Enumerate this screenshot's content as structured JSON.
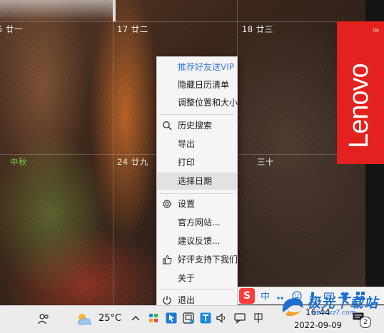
{
  "calendar": {
    "cells": [
      {
        "label": "5 廿一"
      },
      {
        "label": "17 廿二"
      },
      {
        "label": "18 廿三"
      },
      {
        "label": "中秋"
      },
      {
        "label": "24 廿九"
      },
      {
        "label": "三十"
      }
    ]
  },
  "brand": {
    "logo_text": "Lenovo",
    "tm": "TM",
    "color": "#e3211e"
  },
  "context_menu": {
    "items": [
      {
        "label": "推荐好友送VIP",
        "icon": ""
      },
      {
        "label": "隐藏日历清单",
        "icon": ""
      },
      {
        "label": "调整位置和大小",
        "icon": ""
      },
      {
        "label": "历史搜索",
        "icon": "search-icon"
      },
      {
        "label": "导出",
        "icon": ""
      },
      {
        "label": "打印",
        "icon": ""
      },
      {
        "label": "选择日期",
        "icon": "",
        "highlighted": true
      },
      {
        "label": "设置",
        "icon": "gear-icon"
      },
      {
        "label": "官方网站...",
        "icon": ""
      },
      {
        "label": "建议反馈...",
        "icon": ""
      },
      {
        "label": "好评支持下我们",
        "icon": "thumbs-up-icon"
      },
      {
        "label": "关于",
        "icon": ""
      },
      {
        "label": "退出",
        "icon": "power-icon"
      }
    ],
    "accent_color": "#3d7be0"
  },
  "ime_bar": {
    "logo": "S",
    "mode": "中",
    "icons": [
      "punctuation-icon",
      "emoji-icon",
      "microphone-icon",
      "keyboard-icon",
      "shirt-icon",
      "grid-icon"
    ]
  },
  "watermark": {
    "title": "极光下载站",
    "url": "www.xz7.com"
  },
  "taskbar": {
    "weather": {
      "temperature": "25°C",
      "icon": "partly-cloudy-icon"
    },
    "clock": {
      "time": "16:44",
      "date": "2022-09-09"
    },
    "notifications": {
      "count": "2"
    },
    "tray_icons": [
      "people-icon",
      "chevron-up-icon",
      "grid-app-icon",
      "arrow-app-icon",
      "tool-icon",
      "t-app-icon",
      "volume-icon",
      "chat-icon",
      "ime-indicator-icon"
    ]
  }
}
